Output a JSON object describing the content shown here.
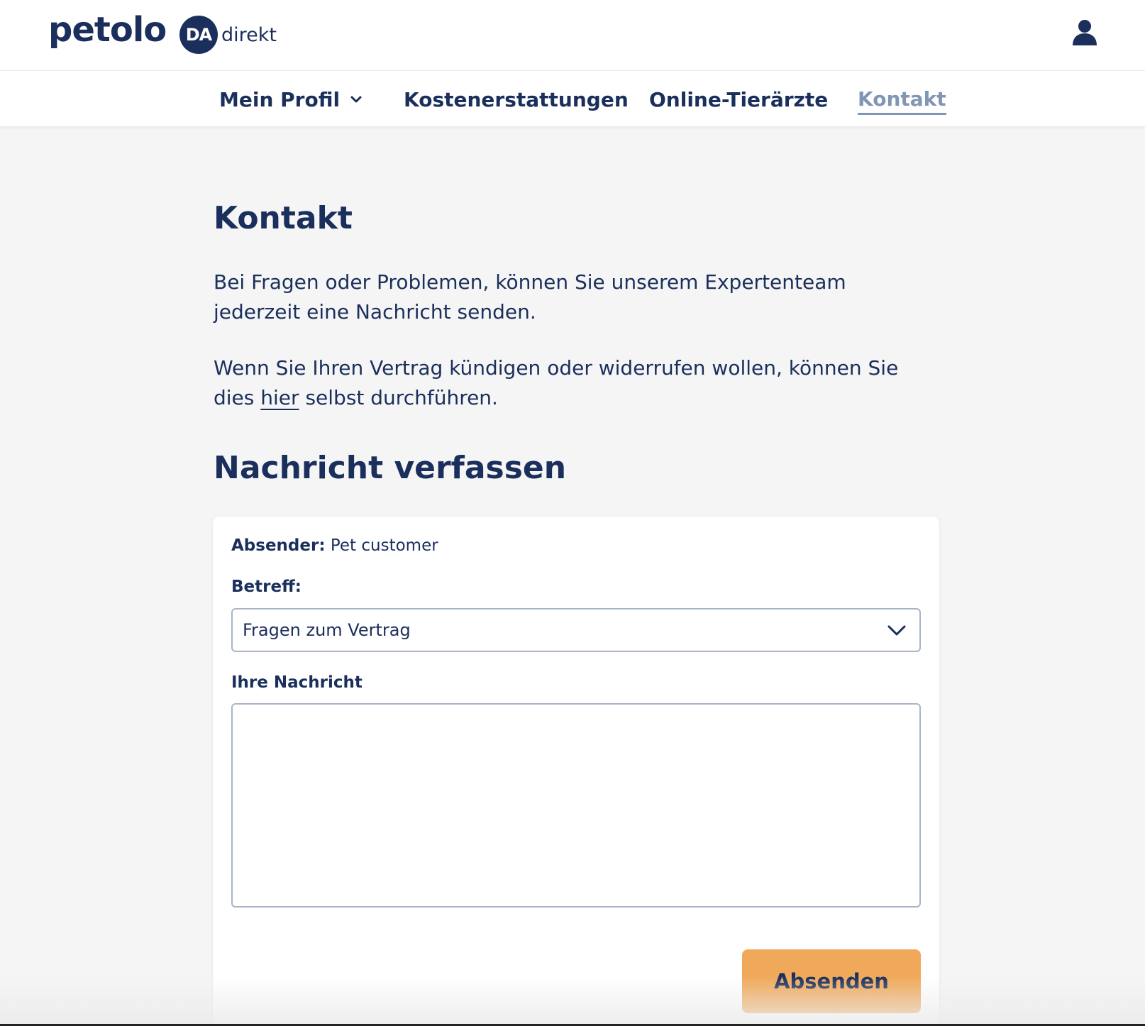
{
  "header": {
    "brand": "petolo",
    "partner_badge": "DA",
    "partner_text": "direkt",
    "user_icon": "user-icon"
  },
  "nav": {
    "items": [
      {
        "label": "Mein Profil",
        "has_dropdown": true
      },
      {
        "label": "Kostenerstattungen"
      },
      {
        "label": "Online-Tierärzte"
      },
      {
        "label": "Kontakt",
        "active": true
      }
    ]
  },
  "main": {
    "title": "Kontakt",
    "intro": "Bei Fragen oder Problemen, können Sie unserem Expertenteam jederzeit eine Nachricht senden.",
    "cancel_text_before": "Wenn Sie Ihren Vertrag kündigen oder widerrufen wollen, können Sie dies ",
    "cancel_link": "hier",
    "cancel_text_after": " selbst durchführen.",
    "section_title": "Nachricht verfassen"
  },
  "form": {
    "sender_label": "Absender:",
    "sender_value": "Pet customer",
    "subject_label": "Betreff:",
    "subject_value": "Fragen zum Vertrag",
    "message_label": "Ihre Nachricht",
    "message_value": "",
    "submit_label": "Absenden"
  },
  "colors": {
    "primary": "#1b2f5c",
    "active_nav": "#8196b4",
    "button": "#f0a95a",
    "background": "#f5f5f5"
  }
}
